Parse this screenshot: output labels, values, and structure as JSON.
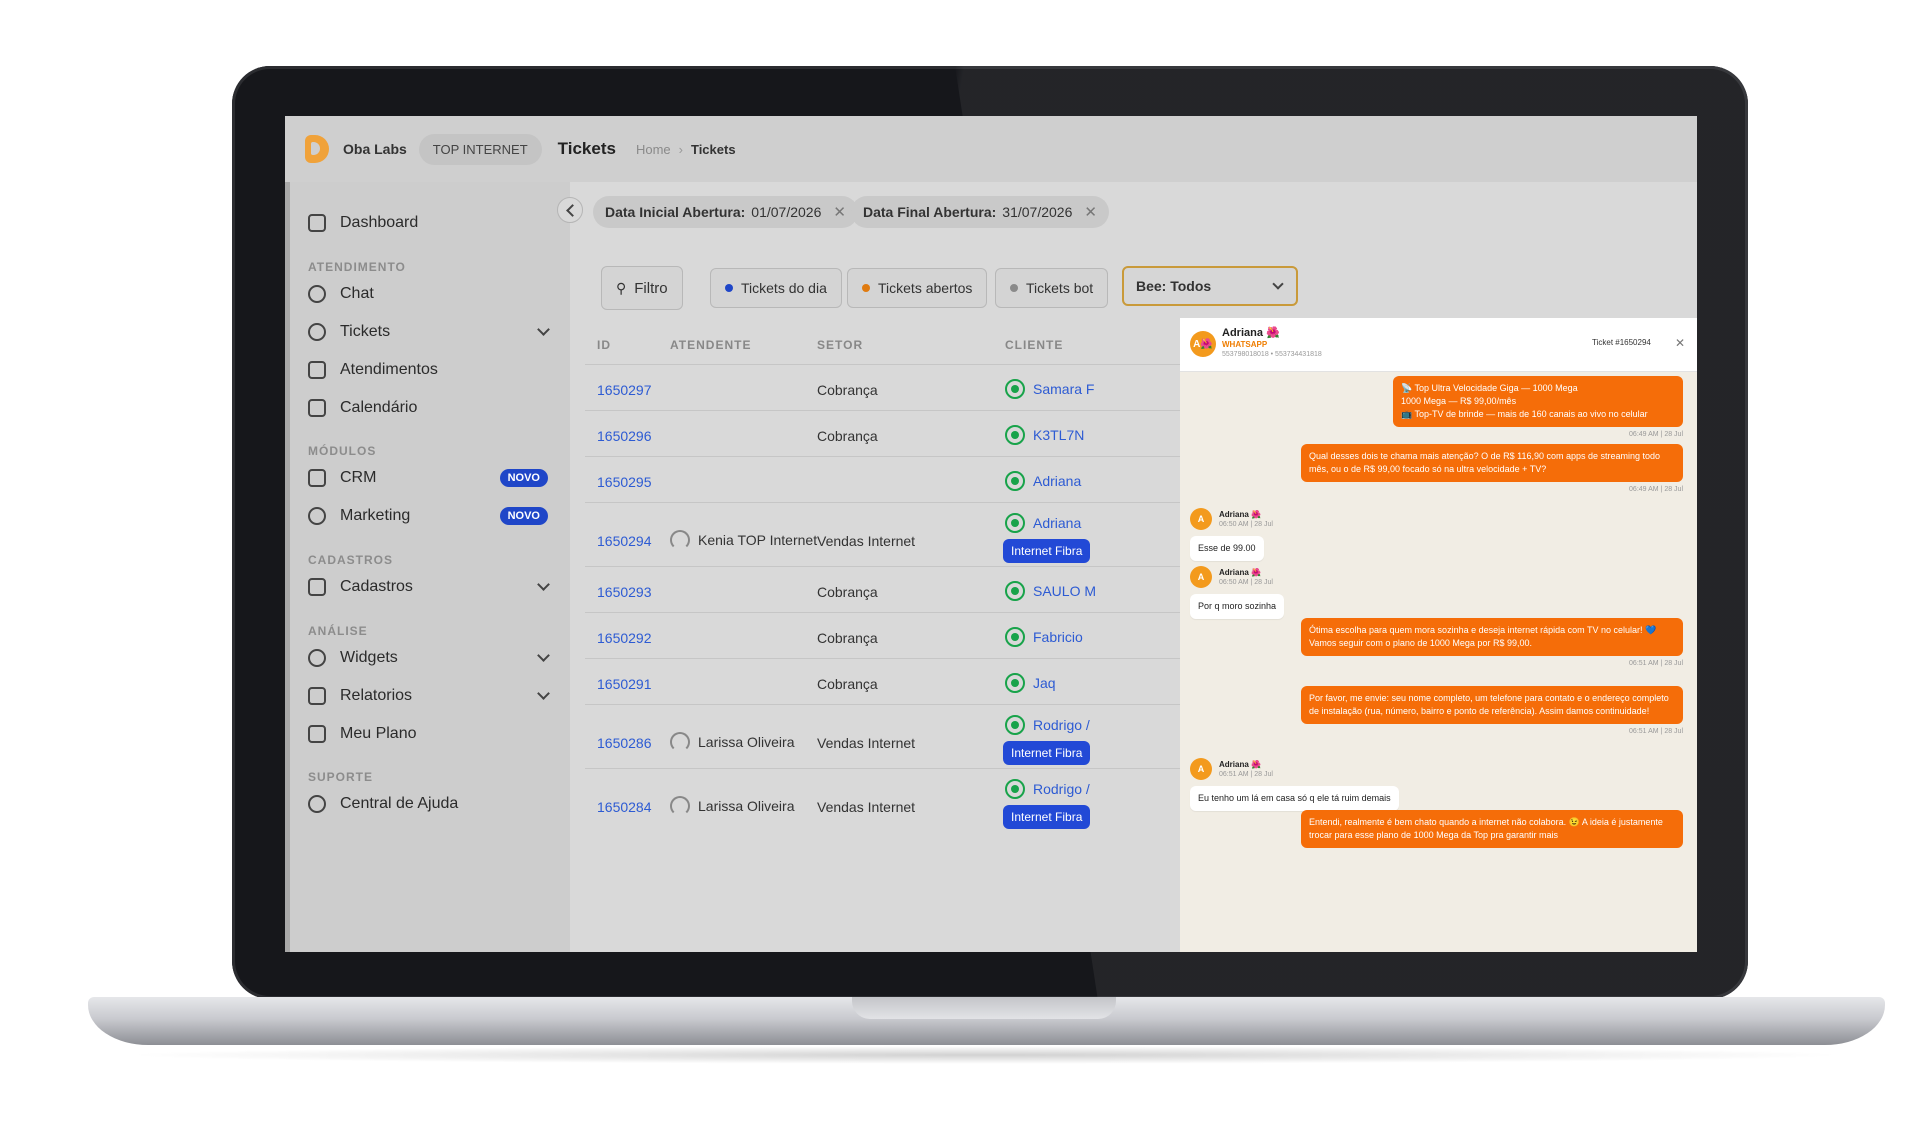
{
  "app": {
    "company": "Oba Labs",
    "workspace": "TOP INTERNET",
    "page_title": "Tickets"
  },
  "breadcrumb": [
    "Home",
    "Tickets"
  ],
  "sidebar": {
    "dashboard": "Dashboard",
    "sec_atendimento": "ATENDIMENTO",
    "chat": "Chat",
    "tickets": "Tickets",
    "atendimentos": "Atendimentos",
    "calendario": "Calendário",
    "sec_modulos": "MÓDULOS",
    "crm": "CRM",
    "marketing": "Marketing",
    "badge_novo": "NOVO",
    "sec_cadastros": "CADASTROS",
    "cadastros": "Cadastros",
    "sec_analise": "ANÁLISE",
    "widgets": "Widgets",
    "relatorios": "Relatorios",
    "meuplano": "Meu Plano",
    "sec_suporte": "SUPORTE",
    "ajuda": "Central de Ajuda"
  },
  "filters": {
    "start_label": "Data Inicial Abertura:",
    "start_value": "01/07/2026",
    "end_label": "Data Final Abertura:",
    "end_value": "31/07/2026",
    "filtro": "Filtro",
    "tickets_dia": "Tickets do dia",
    "tickets_abertos": "Tickets abertos",
    "tickets_bot": "Tickets bot",
    "bee_select": "Bee: Todos",
    "colors": {
      "dia": "#1f46c8",
      "abertos": "#e07b10",
      "bot": "#8a8a8a"
    }
  },
  "table": {
    "headers": {
      "id": "ID",
      "atendente": "ATENDENTE",
      "setor": "SETOR",
      "cliente": "CLIENTE"
    },
    "rows": [
      {
        "id": "1650297",
        "atendente": "",
        "setor": "Cobrança",
        "cliente": "Samara F",
        "tag": ""
      },
      {
        "id": "1650296",
        "atendente": "",
        "setor": "Cobrança",
        "cliente": "K3TL7N",
        "tag": ""
      },
      {
        "id": "1650295",
        "atendente": "",
        "setor": "",
        "cliente": "Adriana",
        "tag": ""
      },
      {
        "id": "1650294",
        "atendente": "Kenia TOP Internet",
        "setor": "Vendas Internet",
        "cliente": "Adriana",
        "tag": "Internet Fibra"
      },
      {
        "id": "1650293",
        "atendente": "",
        "setor": "Cobrança",
        "cliente": "SAULO M",
        "tag": ""
      },
      {
        "id": "1650292",
        "atendente": "",
        "setor": "Cobrança",
        "cliente": "Fabricio",
        "tag": ""
      },
      {
        "id": "1650291",
        "atendente": "",
        "setor": "Cobrança",
        "cliente": "Jaq",
        "tag": ""
      },
      {
        "id": "1650286",
        "atendente": "Larissa Oliveira",
        "setor": "Vendas Internet",
        "cliente": "Rodrigo /",
        "tag": "Internet Fibra"
      },
      {
        "id": "1650284",
        "atendente": "Larissa Oliveira",
        "setor": "Vendas Internet",
        "cliente": "Rodrigo /",
        "tag": "Internet Fibra"
      }
    ]
  },
  "chat": {
    "contact": "Adriana 🌺",
    "avatar": "A🌺",
    "channel": "WHATSAPP",
    "numbers": "553798018018 • 553734431818",
    "ticket": "Ticket #1650294",
    "close": "✕",
    "messages": [
      {
        "dir": "out",
        "text": "📡 Top Ultra Velocidade Giga — 1000 Mega\n1000 Mega — R$ 99,00/mês\n📺 Top-TV de brinde — mais de 160 canais ao vivo no celular",
        "time": "06:49 AM | 28 Jul"
      },
      {
        "dir": "out",
        "text": "Qual desses dois te chama mais atenção? O de R$ 116,90 com apps de streaming todo mês, ou o de R$ 99,00 focado só na ultra velocidade + TV?",
        "time": "06:49 AM | 28 Jul"
      },
      {
        "dir": "in",
        "name": "Adriana 🌺",
        "time": "06:50 AM | 28 Jul",
        "text": "Esse de 99.00"
      },
      {
        "dir": "in",
        "name": "Adriana 🌺",
        "time": "06:50 AM | 28 Jul",
        "text": "Por q moro sozinha"
      },
      {
        "dir": "out",
        "text": "Ótima escolha para quem mora sozinha e deseja internet rápida com TV no celular! 💙\nVamos seguir com o plano de 1000 Mega por R$ 99,00.",
        "time": "06:51 AM | 28 Jul"
      },
      {
        "dir": "out",
        "text": "Por favor, me envie: seu nome completo, um telefone para contato e o endereço completo de instalação (rua, número, bairro e ponto de referência). Assim damos continuidade!",
        "time": "06:51 AM | 28 Jul"
      },
      {
        "dir": "in",
        "name": "Adriana 🌺",
        "time": "06:51 AM | 28 Jul",
        "text": "Eu tenho um lá em casa só q ele tá ruim demais"
      },
      {
        "dir": "out",
        "text": "Entendi, realmente é bem chato quando a internet não colabora. 😉 A ideia é justamente trocar para esse plano de 1000 Mega da Top pra garantir mais",
        "time": ""
      }
    ],
    "colors": {
      "outgoing": "#f56d09",
      "avatar": "#f39a1d"
    }
  }
}
